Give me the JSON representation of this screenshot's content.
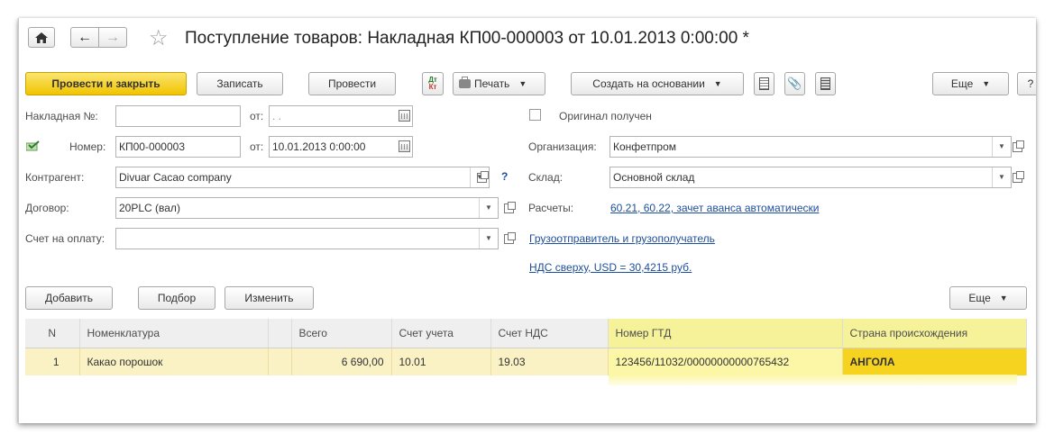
{
  "window": {
    "title": "Поступление товаров: Накладная КП00-000003 от 10.01.2013 0:00:00 *"
  },
  "toolbar": {
    "post_close": "Провести и закрыть",
    "save": "Записать",
    "post": "Провести",
    "print": "Печать",
    "create_based": "Создать на основании",
    "more": "Еще",
    "help": "?"
  },
  "form": {
    "invoice_no_label": "Накладная №:",
    "invoice_no_value": "",
    "from_label": "от:",
    "invoice_date_value": " .  .",
    "number_label": "Номер:",
    "number_value": "КП00-000003",
    "date_value": "10.01.2013  0:00:00",
    "counterparty_label": "Контрагент:",
    "counterparty_value": "Divuar Cacao company",
    "question": "?",
    "contract_label": "Договор:",
    "contract_value": "20PLC (вал)",
    "payment_label": "Счет на оплату:",
    "payment_value": "",
    "original_label": "Оригинал получен",
    "org_label": "Организация:",
    "org_value": "Конфетпром",
    "warehouse_label": "Склад:",
    "warehouse_value": "Основной склад",
    "settlements_label": "Расчеты:",
    "settlements_link": "60.21, 60.22, зачет аванса автоматически",
    "shipper_link": "Грузоотправитель и грузополучатель",
    "vat_link": "НДС сверху, USD = 30,4215 руб."
  },
  "table_toolbar": {
    "add": "Добавить",
    "pick": "Подбор",
    "change": "Изменить",
    "more": "Еще"
  },
  "table": {
    "columns": [
      "N",
      "Номенклатура",
      "",
      "Всего",
      "Счет учета",
      "Счет НДС",
      "Номер ГТД",
      "Страна происхождения"
    ],
    "rows": [
      [
        "1",
        "Какао порошок",
        "",
        "6 690,00",
        "10.01",
        "19.03",
        "123456/11032/00000000000765432",
        "АНГОЛА"
      ]
    ]
  },
  "colors": {
    "accent": "#f1c400",
    "link": "#1c4e9c",
    "row": "#faf2c4",
    "highlight": "#f6f29a"
  }
}
